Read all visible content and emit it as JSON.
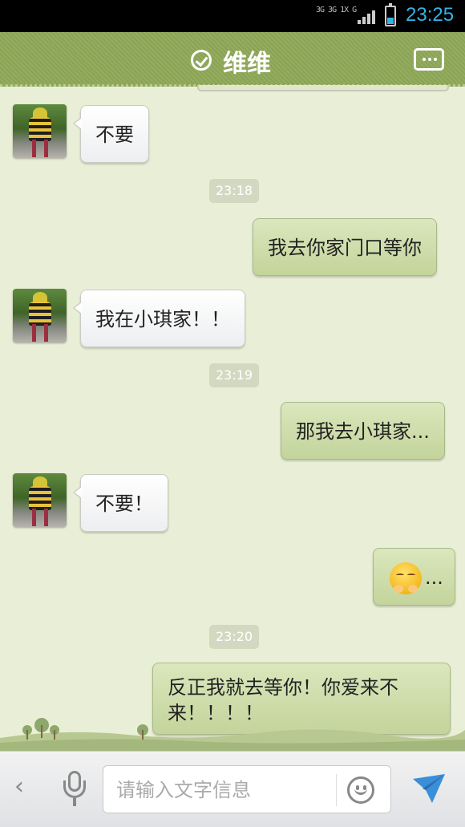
{
  "status_bar": {
    "network": "3G 3G 1X G",
    "time": "23:25",
    "battery_level": 0.35
  },
  "header": {
    "contact_name": "维维"
  },
  "messages": [
    {
      "type": "incoming",
      "text": "不要"
    },
    {
      "type": "timestamp",
      "text": "23:18"
    },
    {
      "type": "outgoing",
      "text": "我去你家门口等你"
    },
    {
      "type": "incoming",
      "text": "我在小琪家！！"
    },
    {
      "type": "timestamp",
      "text": "23:19"
    },
    {
      "type": "outgoing",
      "text": "那我去小琪家..."
    },
    {
      "type": "incoming",
      "text": "不要！"
    },
    {
      "type": "outgoing_emoji",
      "emoji": "blushing-face-emoji",
      "text": "..."
    },
    {
      "type": "timestamp",
      "text": "23:20"
    },
    {
      "type": "outgoing",
      "text": "反正我就去等你！你爱来不来！！！！"
    }
  ],
  "input_bar": {
    "placeholder": "请输入文字信息",
    "value": ""
  },
  "colors": {
    "header_bg": "#8ea857",
    "chat_bg": "#e9efd6",
    "outgoing_bubble": "#c3d49b",
    "incoming_bubble": "#ffffff",
    "clock_blue": "#34b3e4"
  }
}
